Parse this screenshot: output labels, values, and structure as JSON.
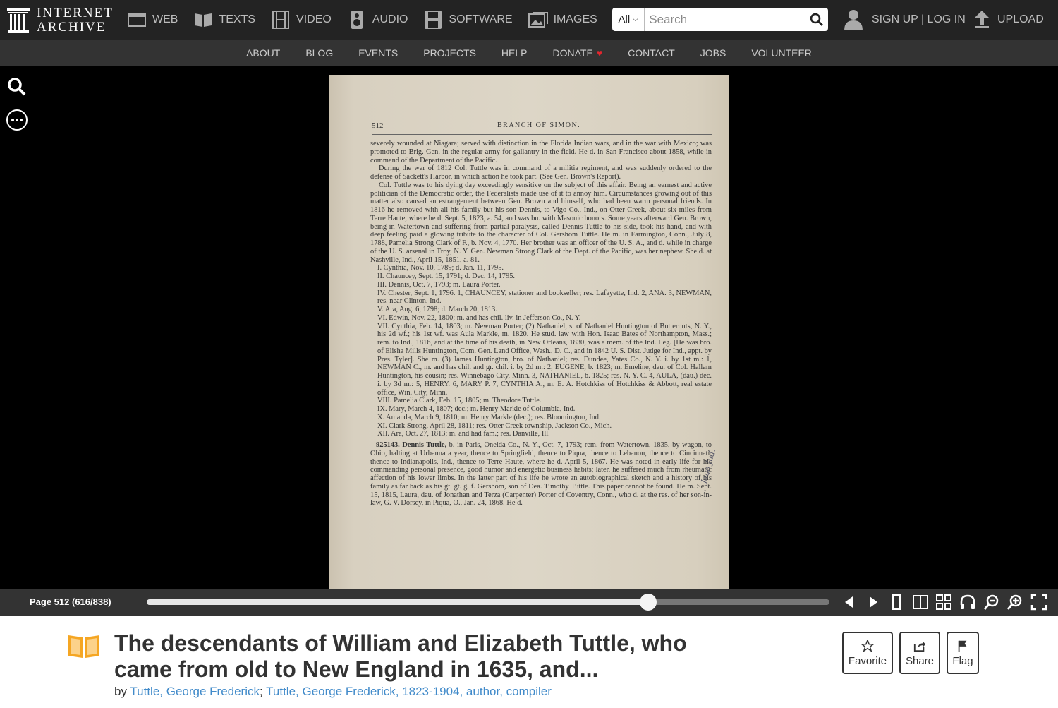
{
  "header": {
    "logo_line1": "INTERNET",
    "logo_line2": "ARCHIVE",
    "media": [
      {
        "label": "WEB",
        "icon": "web-icon"
      },
      {
        "label": "TEXTS",
        "icon": "book-open-icon"
      },
      {
        "label": "VIDEO",
        "icon": "film-icon"
      },
      {
        "label": "AUDIO",
        "icon": "speaker-icon"
      },
      {
        "label": "SOFTWARE",
        "icon": "floppy-disk-icon"
      },
      {
        "label": "IMAGES",
        "icon": "picture-icon"
      }
    ],
    "search": {
      "scope": "All",
      "placeholder": "Search"
    },
    "account": "SIGN UP | LOG IN",
    "upload": "UPLOAD"
  },
  "subnav": [
    "ABOUT",
    "BLOG",
    "EVENTS",
    "PROJECTS",
    "HELP",
    "DONATE",
    "CONTACT",
    "JOBS",
    "VOLUNTEER"
  ],
  "viewer": {
    "page_number": "512",
    "running_head": "BRANCH OF SIMON.",
    "paragraphs": [
      "severely wounded at Niagara; served with distinction in the Florida Indian wars, and in the war with Mexico; was promoted to Brig. Gen. in the regular army for gallantry in the field. He d. in San Francisco about 1858, while in command of the Department of the Pacific.",
      "During the war of 1812 Col. Tuttle was in command of a militia regiment, and was suddenly ordered to the defense of Sackett's Harbor, in which action he took part. (See Gen. Brown's Report).",
      "Col. Tuttle was to his dying day exceedingly sensitive on the subject of this affair. Being an earnest and active politician of the Democratic order, the Federalists made use of it to annoy him. Circumstances growing out of this matter also caused an estrangement between Gen. Brown and himself, who had been warm personal friends. In 1816 he removed with all his family but his son Dennis, to Vigo Co., Ind., on Otter Creek, about six miles from Terre Haute, where he d. Sept. 5, 1823, a. 54, and was bu. with Masonic honors. Some years afterward Gen. Brown, being in Watertown and suffering from partial paralysis, called Dennis Tuttle to his side, took his hand, and with deep feeling paid a glowing tribute to the character of Col. Gershom Tuttle. He m. in Farmington, Conn., July 8, 1788, Pamelia Strong Clark of F., b. Nov. 4, 1770. Her brother was an officer of the U. S. A., and d. while in charge of the U. S. arsenal in Troy, N. Y. Gen. Newman Strong Clark of the Dept. of the Pacific, was her nephew. She d. at Nashville, Ind., April 15, 1851, a. 81."
    ],
    "children": [
      "I. Cynthia, Nov. 10, 1789; d. Jan. 11, 1795.",
      "II. Chauncey, Sept. 15, 1791; d. Dec. 14, 1795.",
      "III. Dennis, Oct. 7, 1793; m. Laura Porter.",
      "IV. Chester, Sept. 1, 1796. 1, CHAUNCEY, stationer and bookseller; res. Lafayette, Ind. 2, ANA. 3, NEWMAN, res. near Clinton, Ind.",
      "V. Ara, Aug. 6, 1798; d. March 20, 1813.",
      "VI. Edwin, Nov. 22, 1800; m. and has chil. liv. in Jefferson Co., N. Y.",
      "VII. Cynthia, Feb. 14, 1803; m. Newman Porter; (2) Nathaniel, s. of Nathaniel Huntington of Butternuts, N. Y., his 2d wf.; his 1st wf. was Aula Markle, m. 1820. He stud. law with Hon. Isaac Bates of Northampton, Mass.; rem. to Ind., 1816, and at the time of his death, in New Orleans, 1830, was a mem. of the Ind. Leg. [He was bro. of Elisha Mills Huntington, Com. Gen. Land Office, Wash., D. C., and in 1842 U. S. Dist. Judge for Ind., appt. by Pres. Tyler]. She m. (3) James Huntington, bro. of Nathaniel; res. Dundee, Yates Co., N. Y. i. by 1st m.: 1, NEWMAN C., m. and has chil. and gr. chil. i. by 2d m.: 2, EUGENE, b. 1823; m. Emeline, dau. of Col. Hallam Huntington, his cousin; res. Winnebago City, Minn. 3, NATHANIEL, b. 1825; res. N. Y. C. 4, AULA, (dau.) dec. i. by 3d m.: 5, HENRY. 6, MARY P. 7, CYNTHIA A., m. E. A. Hotchkiss of Hotchkiss & Abbott, real estate office, Win. City, Minn.",
      "VIII. Pamelia Clark, Feb. 15, 1805; m. Theodore Tuttle.",
      "IX. Mary, March 4, 1807; dec.; m. Henry Markle of Columbia, Ind.",
      "X. Amanda, March 9, 1810; m. Henry Markle (dec.); res. Bloomington, Ind.",
      "XI. Clark Strong, April 28, 1811; res. Otter Creek township, Jackson Co., Mich.",
      "XII. Ara, Oct. 27, 1813; m. and had fam.; res. Danville, Ill."
    ],
    "entry_number": "925143.",
    "entry_name": "Dennis Tuttle,",
    "entry_text": "b. in Paris, Oneida Co., N. Y., Oct. 7, 1793; rem. from Watertown, 1835, by wagon, to Ohio, halting at Urbanna a year, thence to Springfield, thence to Piqua, thence to Lebanon, thence to Cincinnati, thence to Indianapolis, Ind., thence to Terre Haute, where he d. April 5, 1867. He was noted in early life for his commanding personal presence, good humor and energetic business habits; later, he suffered much from rheumatic affection of his lower limbs. In the latter part of his life he wrote an autobiographical sketch and a history of his family as far back as his gt. gt. g. f. Gershom, son of Dea. Timothy Tuttle. This paper cannot be found. He m. Sept. 15, 1815, Laura, dau. of Jonathan and Terza (Carpenter) Porter of Coventry, Conn., who d. at the res. of her son-in-law, G. V. Dorsey, in Piqua, O., Jan. 24, 1868. He d.",
    "margin_note": "Jago Jud.",
    "page_label": "Page 512 (616/838)",
    "progress_fraction": 0.735
  },
  "book": {
    "title": "The descendants of William and Elizabeth Tuttle, who came from old to New England in 1635, and...",
    "by_label": "by",
    "authors": [
      "Tuttle, George Frederick",
      "Tuttle, George Frederick, 1823-1904, author, compiler"
    ],
    "actions": [
      "Favorite",
      "Share",
      "Flag"
    ]
  },
  "colors": {
    "accent_link": "#428bca",
    "heart": "#e3262e",
    "book_icon": "#f5a623"
  }
}
